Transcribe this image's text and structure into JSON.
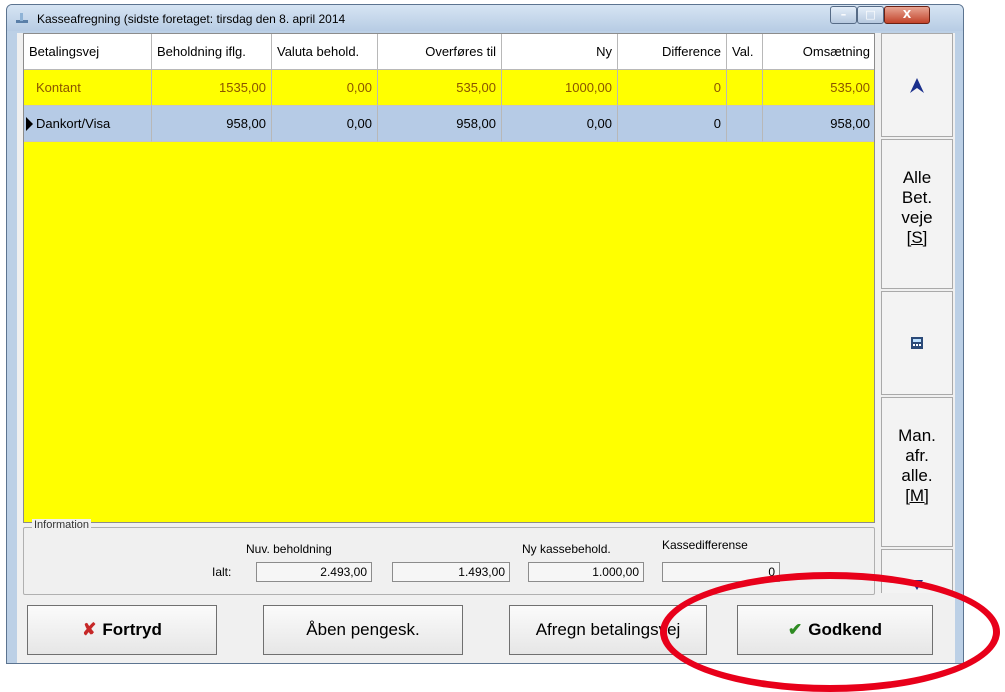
{
  "window": {
    "title": "Kasseafregning (sidste foretaget: tirsdag den 8. april 2014",
    "buttons": {
      "minimize": "–",
      "maximize": "□",
      "close": "X"
    }
  },
  "grid": {
    "columns": [
      "Betalingsvej",
      "Beholdning iflg.",
      "Valuta behold.",
      "Overføres til",
      "Ny",
      "Difference",
      "Val.",
      "Omsætning"
    ],
    "rows": [
      [
        "Kontant",
        "1535,00",
        "0,00",
        "535,00",
        "1000,00",
        "0",
        "",
        "535,00"
      ],
      [
        "Dankort/Visa",
        "958,00",
        "0,00",
        "958,00",
        "0,00",
        "0",
        "",
        "958,00"
      ]
    ]
  },
  "sidebar": {
    "up_icon": "arrow-up-icon",
    "alle_lines": [
      "Alle",
      "Bet.",
      "veje",
      "[S]"
    ],
    "calculator_icon": "calculator-icon",
    "man_lines": [
      "Man.",
      "afr.",
      "alle.",
      "[M]"
    ],
    "down_icon": "arrow-down-icon"
  },
  "info": {
    "legend": "Information",
    "ialt_label": "Ialt:",
    "nuv_label": "Nuv. beholdning",
    "nuv_value": "2.493,00",
    "overfor_value": "1.493,00",
    "ny_label": "Ny kassebehold.",
    "ny_value": "1.000,00",
    "diff_label": "Kassedifferense",
    "diff_value": "0"
  },
  "buttons": {
    "fortryd": "Fortryd",
    "aaben": "Åben pengesk.",
    "afregn": "Afregn betalingsvej",
    "godkend": "Godkend"
  },
  "colors": {
    "grid_bg": "#ffff00",
    "selected_row": "#b6cbe6",
    "highlight_oval": "#e8001a"
  }
}
